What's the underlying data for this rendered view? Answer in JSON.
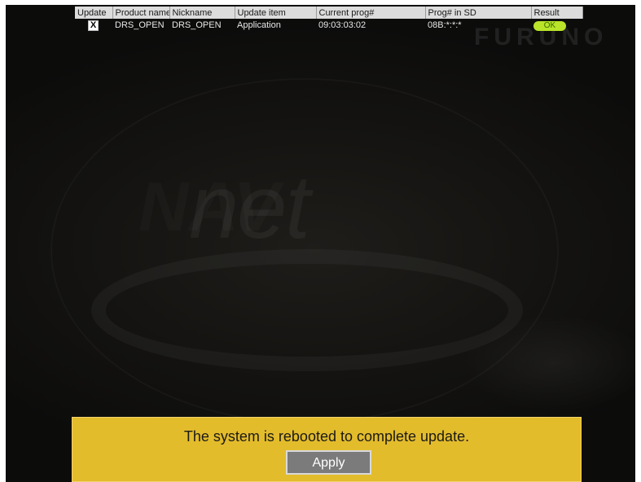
{
  "table": {
    "headers": {
      "update": "Update",
      "product_name": "Product name",
      "nickname": "Nickname",
      "update_item": "Update item",
      "current_prog": "Current prog#",
      "prog_in_sd": "Prog# in SD",
      "result": "Result"
    },
    "rows": [
      {
        "update_checked": true,
        "update_mark": "X",
        "product_name": "DRS_OPEN",
        "nickname": "DRS_OPEN",
        "update_item": "Application",
        "current_prog": "09:03:03:02",
        "prog_in_sd": "08B:*:*:*",
        "result": "OK"
      }
    ]
  },
  "dialog": {
    "message": "The system is rebooted to complete update.",
    "apply_label": "Apply"
  },
  "colors": {
    "dialog_bg": "#e3bc2c",
    "ok_badge": "#b9e42a",
    "screen_bg": "#141311"
  },
  "background": {
    "watermark": "net",
    "brand": "FURUNO"
  }
}
